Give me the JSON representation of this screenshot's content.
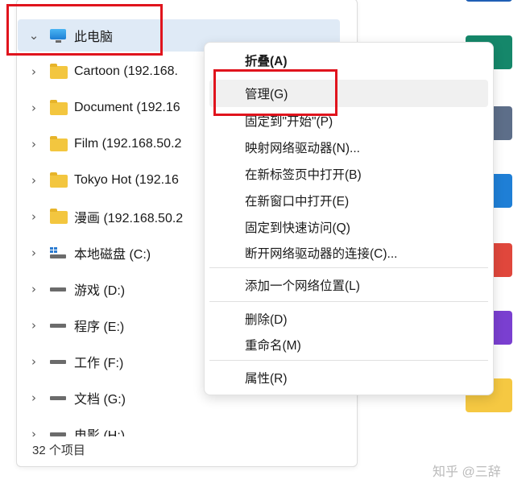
{
  "tree": {
    "items": [
      {
        "label": "此电脑",
        "icon": "monitor-icon",
        "expanded": true
      },
      {
        "label": "Cartoon (192.168.",
        "icon": "folder-icon"
      },
      {
        "label": "Document (192.16",
        "icon": "folder-icon"
      },
      {
        "label": "Film (192.168.50.2",
        "icon": "folder-icon"
      },
      {
        "label": "Tokyo Hot (192.16",
        "icon": "folder-icon"
      },
      {
        "label": "漫画 (192.168.50.2",
        "icon": "folder-icon"
      },
      {
        "label": "本地磁盘 (C:)",
        "icon": "windows-drive-icon"
      },
      {
        "label": "游戏 (D:)",
        "icon": "drive-icon"
      },
      {
        "label": "程序 (E:)",
        "icon": "drive-icon"
      },
      {
        "label": "工作 (F:)",
        "icon": "drive-icon"
      },
      {
        "label": "文档 (G:)",
        "icon": "drive-icon"
      },
      {
        "label": "电影 (H:)",
        "icon": "drive-icon"
      }
    ],
    "chevron_collapsed": "›",
    "chevron_expanded": "⌄"
  },
  "status": {
    "item_count": "32 个项目"
  },
  "context_menu": {
    "items": [
      {
        "label": "折叠(A)",
        "bold": true
      },
      {
        "label": "管理(G)",
        "hover": true
      },
      {
        "label": "固定到\"开始\"(P)"
      },
      {
        "label": "映射网络驱动器(N)..."
      },
      {
        "label": "在新标签页中打开(B)"
      },
      {
        "label": "在新窗口中打开(E)"
      },
      {
        "label": "固定到快速访问(Q)"
      },
      {
        "label": "断开网络驱动器的连接(C)..."
      },
      {
        "label": "添加一个网络位置(L)"
      },
      {
        "label": "删除(D)"
      },
      {
        "label": "重命名(M)"
      },
      {
        "label": "属性(R)"
      }
    ]
  },
  "watermark": "知乎 @三辞",
  "colors": {
    "highlight": "#e0141d",
    "selection": "#dfeaf6",
    "folder": "#f3c63f",
    "accent": "#1e7fd4"
  },
  "side_tiles": [
    {
      "icon": "app-tile-blue-icon",
      "color": "#1f5fb5"
    },
    {
      "icon": "app-tile-green-icon",
      "color": "#15876a"
    },
    {
      "icon": "app-tile-gray-icon",
      "color": "#5d6e89"
    },
    {
      "icon": "app-tile-sky-icon",
      "color": "#1f7fd6"
    },
    {
      "icon": "app-tile-red-icon",
      "color": "#e0473c"
    },
    {
      "icon": "app-tile-purple-icon",
      "color": "#7a3fd0"
    },
    {
      "icon": "app-tile-yellow-icon",
      "color": "#f5c842"
    }
  ]
}
